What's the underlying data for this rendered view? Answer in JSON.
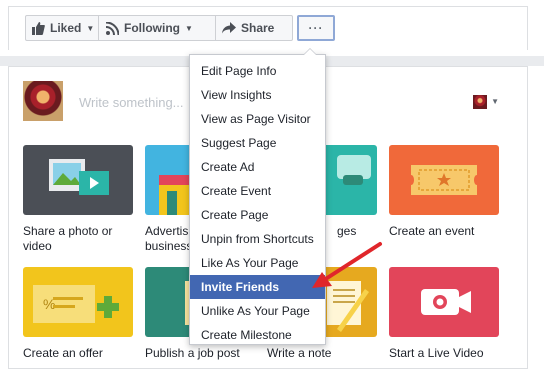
{
  "toolbar": {
    "liked_label": "Liked",
    "following_label": "Following",
    "share_label": "Share",
    "more_label": "···"
  },
  "composer": {
    "placeholder": "Write something..."
  },
  "tiles": [
    {
      "label": "Share a photo or video",
      "color": "#4b4f56"
    },
    {
      "label": "Advertise your business",
      "visible_text": "Advertis business",
      "color": "#42b4e0"
    },
    {
      "label": "Get messages",
      "visible_text": "ges",
      "color": "#2bb5a8"
    },
    {
      "label": "Create an event",
      "color": "#f0693a"
    },
    {
      "label": "Create an offer",
      "color": "#f2c51c"
    },
    {
      "label": "Publish a job post",
      "color": "#2d8a78"
    },
    {
      "label": "Write a note",
      "color": "#e6a91f"
    },
    {
      "label": "Start a Live Video",
      "color": "#e2455a"
    }
  ],
  "menu": {
    "items": [
      "Edit Page Info",
      "View Insights",
      "View as Page Visitor",
      "Suggest Page",
      "Create Ad",
      "Create Event",
      "Create Page",
      "Unpin from Shortcuts",
      "Like As Your Page",
      "Invite Friends",
      "Unlike As Your Page",
      "Create Milestone"
    ],
    "active_index": 9,
    "active_color": "#4267b2"
  },
  "annotation": {
    "arrow_color": "#e0262b"
  }
}
